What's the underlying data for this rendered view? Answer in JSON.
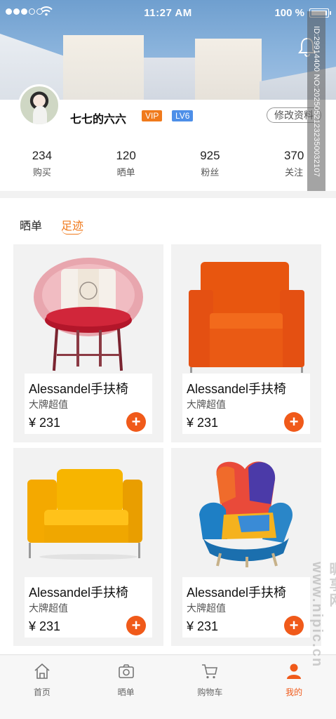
{
  "status_bar": {
    "time": "11:27 AM",
    "battery": "100 %",
    "signal_bars_on": 3,
    "signal_bars_total": 5
  },
  "profile": {
    "username": "七七的六六",
    "vip_badge": "VIP",
    "level_badge": "LV6",
    "edit_label": "修改资料",
    "stats": [
      {
        "value": "234",
        "label": "购买"
      },
      {
        "value": "120",
        "label": "晒单"
      },
      {
        "value": "925",
        "label": "粉丝"
      },
      {
        "value": "370",
        "label": "关注"
      }
    ]
  },
  "tabs": {
    "items": [
      "晒单",
      "足迹"
    ],
    "active": "足迹"
  },
  "products": [
    {
      "name": "Alessandel手扶椅",
      "subtitle": "大牌超值",
      "price": "¥ 231",
      "add": "+",
      "chair": "pink-lounge-chair"
    },
    {
      "name": "Alessandel手扶椅",
      "subtitle": "大牌超值",
      "price": "¥ 231",
      "add": "+",
      "chair": "orange-armchair"
    },
    {
      "name": "Alessandel手扶椅",
      "subtitle": "大牌超值",
      "price": "¥ 231",
      "add": "+",
      "chair": "yellow-armchair"
    },
    {
      "name": "Alessandel手扶椅",
      "subtitle": "大牌超值",
      "price": "¥ 231",
      "add": "+",
      "chair": "multicolor-wingback-chair"
    }
  ],
  "tabbar": {
    "items": [
      {
        "label": "首页",
        "icon": "home-icon"
      },
      {
        "label": "晒单",
        "icon": "camera-icon"
      },
      {
        "label": "购物车",
        "icon": "cart-icon"
      },
      {
        "label": "我的",
        "icon": "user-icon"
      }
    ],
    "active": "我的"
  },
  "colors": {
    "accent": "#f05a1a",
    "vip": "#f07a1c",
    "level": "#4d8fe8",
    "tab_active": "#f07a1c"
  },
  "watermark": {
    "id_text": "ID:29914400 NO:20250521232350032107",
    "site": "昵享网 www.nipic.cn"
  }
}
